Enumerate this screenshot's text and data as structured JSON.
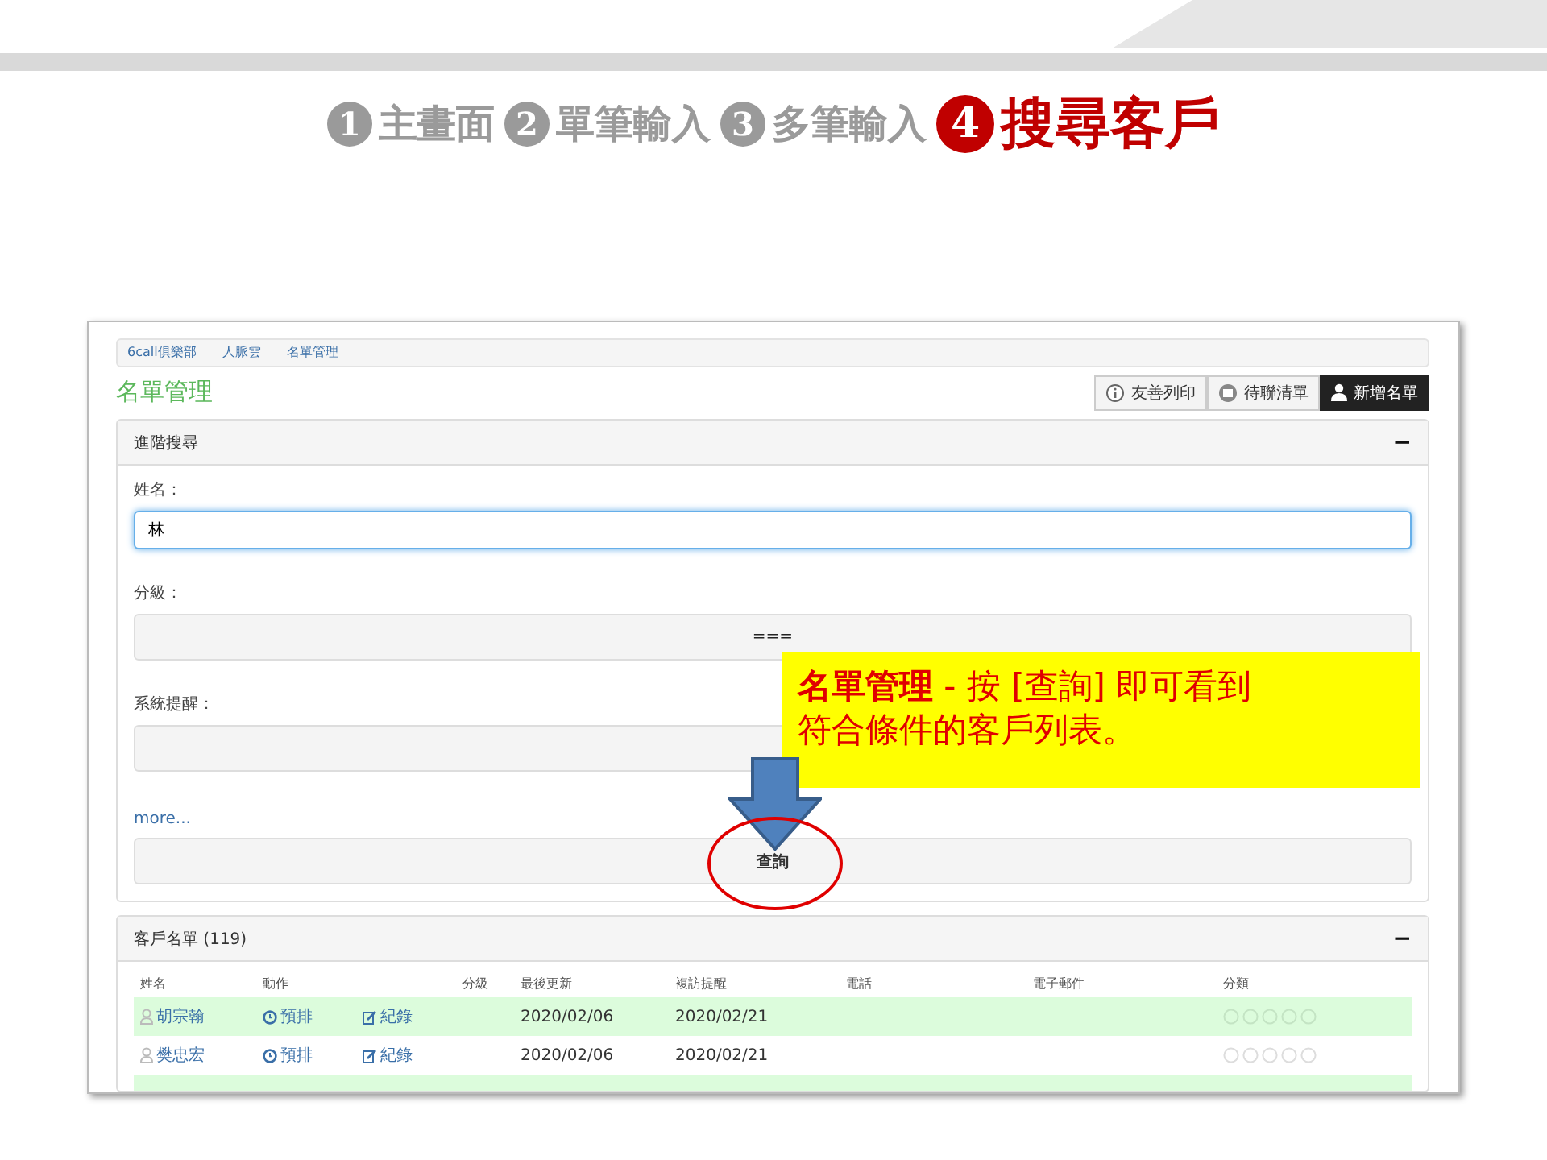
{
  "steps": [
    {
      "number": "1",
      "label": "主畫面",
      "selected": false
    },
    {
      "number": "2",
      "label": "單筆輸入",
      "selected": false
    },
    {
      "number": "3",
      "label": "多筆輸入",
      "selected": false
    },
    {
      "number": "4",
      "label": "搜尋客戶",
      "selected": true
    }
  ],
  "breadcrumb": [
    "6call俱樂部",
    "人脈雲",
    "名單管理"
  ],
  "page_title": "名單管理",
  "toolbar": [
    {
      "label": "友善列印",
      "kind": "info",
      "selected": false
    },
    {
      "label": "待聯清單",
      "kind": "calendar",
      "selected": false
    },
    {
      "label": "新增名單",
      "kind": "user",
      "selected": true
    }
  ],
  "search_panel": {
    "title": "進階搜尋",
    "collapse": "−",
    "fields": [
      {
        "label": "姓名：",
        "kind": "text",
        "value": "林",
        "focused": true
      },
      {
        "label": "分級：",
        "kind": "select",
        "value": "==="
      },
      {
        "label": "系統提醒：",
        "kind": "select"
      }
    ],
    "more_link": "more...",
    "submit": "查詢"
  },
  "list_panel": {
    "title": "客戶名單 (119)",
    "collapse": "−",
    "columns": [
      "姓名",
      "動作",
      "",
      "分級",
      "最後更新",
      "複訪提醒",
      "電話",
      "電子郵件",
      "分類"
    ],
    "rows": [
      {
        "name": "胡宗翰",
        "action_1": "預排",
        "action_2": "紀錄",
        "last_update": "2020/02/06",
        "reminder": "2020/02/21",
        "highlighted": true
      },
      {
        "name": "樊忠宏",
        "action_1": "預排",
        "action_2": "紀錄",
        "last_update": "2020/02/06",
        "reminder": "2020/02/21",
        "highlighted": false
      }
    ]
  },
  "callout": {
    "text": "**名單管理** - 按 [查詢] 即可看到符合條件的客戶列表。"
  }
}
